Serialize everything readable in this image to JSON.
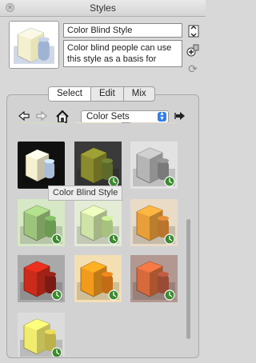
{
  "window": {
    "title": "Styles"
  },
  "style": {
    "name": "Color Blind Style",
    "description": "Color blind people can use this style as a basis for"
  },
  "tabs": [
    {
      "label": "Select",
      "active": true
    },
    {
      "label": "Edit",
      "active": false
    },
    {
      "label": "Mix",
      "active": false
    }
  ],
  "collection": {
    "selected": "Color Sets"
  },
  "tooltip": "Color Blind Style",
  "icons": {
    "close": "close-icon",
    "update": "update-style-icon",
    "create": "create-style-icon",
    "refresh": "refresh-icon",
    "back": "back-arrow-icon",
    "forward": "forward-arrow-icon",
    "home": "home-icon",
    "details": "details-arrow-icon"
  },
  "thumbnails": [
    {
      "name": "Color Blind Style",
      "bg": "#101010",
      "box": "#f4f0d0",
      "cyl": "#a9bcd8",
      "badge": false
    },
    {
      "name": "",
      "bg": "#3a3a3a",
      "box": "#8a8b2e",
      "cyl": "#5c6a2a",
      "badge": true
    },
    {
      "name": "",
      "bg": "#e2e2e2",
      "box": "#b5b5b5",
      "cyl": "#7a7a7a",
      "badge": true
    },
    {
      "name": "",
      "bg": "#d7e8c6",
      "box": "#9cc47a",
      "cyl": "#6b9a52",
      "badge": true
    },
    {
      "name": "",
      "bg": "#e4ecd6",
      "box": "#cfe2a7",
      "cyl": "#a7c27c",
      "badge": true
    },
    {
      "name": "",
      "bg": "#e9dbc6",
      "box": "#e89f3a",
      "cyl": "#b9742e",
      "badge": true
    },
    {
      "name": "",
      "bg": "#a9a9a9",
      "box": "#cc2a1a",
      "cyl": "#7c1b13",
      "badge": true
    },
    {
      "name": "",
      "bg": "#f4dfb3",
      "box": "#f09a1e",
      "cyl": "#c26d16",
      "badge": true
    },
    {
      "name": "",
      "bg": "#b29890",
      "box": "#d66a3c",
      "cyl": "#9a4b36",
      "badge": true
    },
    {
      "name": "",
      "bg": "#dcdcdc",
      "box": "#f2ec6e",
      "cyl": "#bdb24a",
      "badge": true
    }
  ]
}
